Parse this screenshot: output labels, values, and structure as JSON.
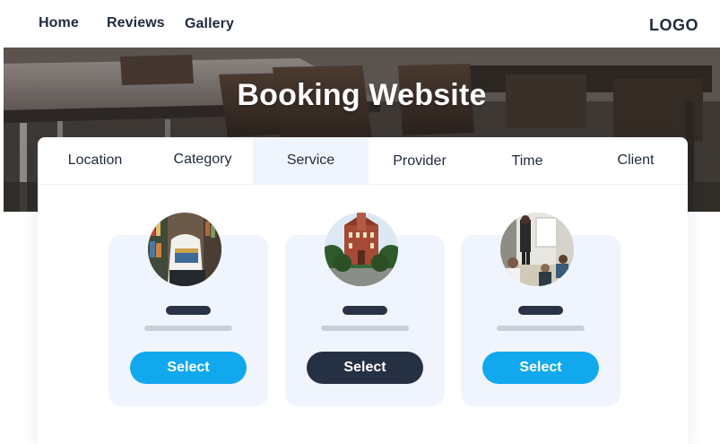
{
  "nav": {
    "links": [
      "Home",
      "Reviews",
      "Gallery"
    ],
    "logo": "LOGO"
  },
  "hero": {
    "title": "Booking Website"
  },
  "tabs": [
    "Location",
    "Category",
    "Service",
    "Provider",
    "Time",
    "Client"
  ],
  "active_tab": "Service",
  "cards": [
    {
      "image_icon": "person-with-books-photo",
      "button_label": "Select",
      "selected": false
    },
    {
      "image_icon": "building-photo",
      "button_label": "Select",
      "selected": true
    },
    {
      "image_icon": "meeting-presentation-photo",
      "button_label": "Select",
      "selected": false
    }
  ],
  "colors": {
    "accent_blue": "#12a8ee",
    "dark_button": "#263043",
    "text_dark": "#1f2a3d",
    "card_bg": "#f0f5fd"
  }
}
